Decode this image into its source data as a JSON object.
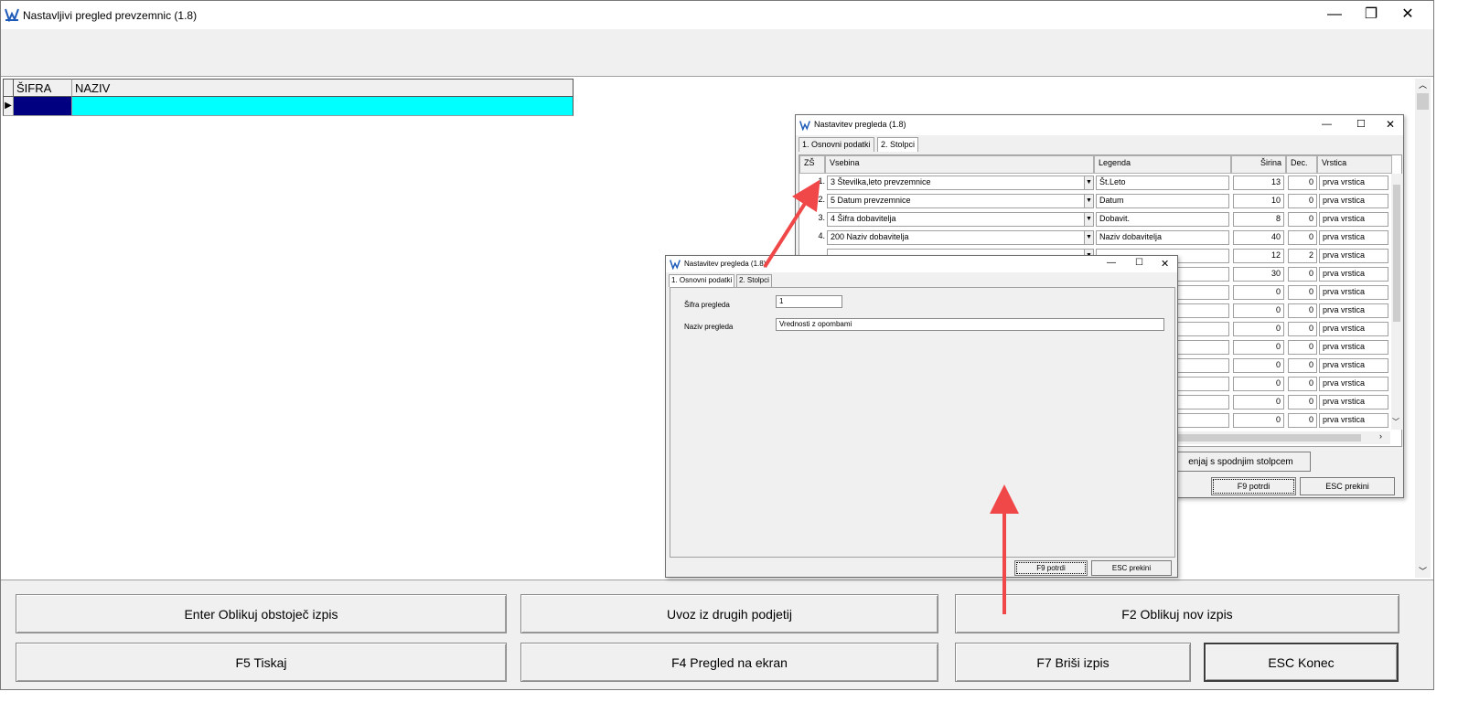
{
  "app": {
    "title": "Nastavljivi pregled prevzemnic  (1.8)",
    "controls": {
      "minimize": "—",
      "maximize": "❐",
      "close": "✕"
    }
  },
  "grid": {
    "columns": [
      "ŠIFRA",
      "NAZIV"
    ],
    "row_marker": "▶"
  },
  "buttons": {
    "enter_edit": "Enter Oblikuj obstoječ izpis",
    "import": "Uvoz iz drugih podjetij",
    "f2_new": "F2 Oblikuj nov izpis",
    "f5_print": "F5 Tiskaj",
    "f4_preview": "F4 Pregled na ekran",
    "f7_delete": "F7 Briši izpis",
    "esc_end": "ESC Konec"
  },
  "dialog_back": {
    "title": "Nastavitev pregleda  (1.8)",
    "tabs": [
      "1. Osnovni podatki",
      "2. Stolpci"
    ],
    "headers": [
      "ZŠ",
      "Vsebina",
      "Legenda",
      "Širina",
      "Dec.",
      "Vrstica"
    ],
    "rows": [
      {
        "n": "1.",
        "content": "3 Številka,leto prevzemnice",
        "legend": "Št.Leto",
        "width": "13",
        "dec": "0",
        "row": "prva vrstica"
      },
      {
        "n": "2.",
        "content": "5 Datum prevzemnice",
        "legend": "Datum",
        "width": "10",
        "dec": "0",
        "row": "prva vrstica"
      },
      {
        "n": "3.",
        "content": "4 Šifra dobavitelja",
        "legend": "Dobavit.",
        "width": "8",
        "dec": "0",
        "row": "prva vrstica"
      },
      {
        "n": "4.",
        "content": "200 Naziv dobavitelja",
        "legend": "Naziv dobavitelja",
        "width": "40",
        "dec": "0",
        "row": "prva vrstica"
      },
      {
        "n": "",
        "content": "",
        "legend": "",
        "width": "12",
        "dec": "2",
        "row": "prva vrstica"
      },
      {
        "n": "",
        "content": "",
        "legend": "",
        "width": "30",
        "dec": "0",
        "row": "prva vrstica"
      },
      {
        "n": "",
        "content": "",
        "legend": "",
        "width": "0",
        "dec": "0",
        "row": "prva vrstica"
      },
      {
        "n": "",
        "content": "",
        "legend": "",
        "width": "0",
        "dec": "0",
        "row": "prva vrstica"
      },
      {
        "n": "",
        "content": "",
        "legend": "",
        "width": "0",
        "dec": "0",
        "row": "prva vrstica"
      },
      {
        "n": "",
        "content": "",
        "legend": "",
        "width": "0",
        "dec": "0",
        "row": "prva vrstica"
      },
      {
        "n": "",
        "content": "",
        "legend": "",
        "width": "0",
        "dec": "0",
        "row": "prva vrstica"
      },
      {
        "n": "",
        "content": "",
        "legend": "",
        "width": "0",
        "dec": "0",
        "row": "prva vrstica"
      },
      {
        "n": "",
        "content": "",
        "legend": "",
        "width": "0",
        "dec": "0",
        "row": "prva vrstica"
      },
      {
        "n": "",
        "content": "",
        "legend": "",
        "width": "0",
        "dec": "0",
        "row": "prva vrstica"
      }
    ],
    "swap_button": "enjaj s spodnjim stolpcem",
    "confirm": "F9  potrdi",
    "cancel": "ESC  prekini"
  },
  "dialog_front": {
    "title": "Nastavitev pregleda  (1.8)",
    "tabs": [
      "1. Osnovni podatki",
      "2. Stolpci"
    ],
    "code_label": "Šifra pregleda",
    "code_value": "1",
    "name_label": "Naziv pregleda",
    "name_value": "Vrednosti z opombami",
    "confirm": "F9  potrdi",
    "cancel": "ESC  prekini"
  },
  "colors": {
    "grid_selected_code": "#000080",
    "grid_selected_name": "#00ffff",
    "arrow": "#f04848"
  }
}
